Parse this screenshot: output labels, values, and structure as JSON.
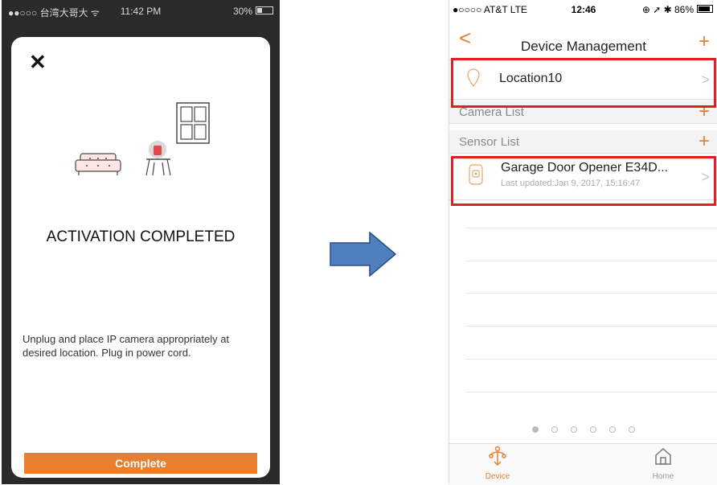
{
  "left": {
    "status": {
      "carrier": "●●○○○ 台湾大哥大 ᯤ",
      "time": "11:42 PM",
      "battery": "30%"
    },
    "close_label": "✕",
    "title": "ACTIVATION COMPLETED",
    "instruction": "Unplug and place IP camera appropriately at desired location. Plug in power cord.",
    "complete_label": "Complete"
  },
  "right": {
    "status": {
      "carrier": "●○○○○ AT&T  LTE",
      "time": "12:46",
      "icons": "⊕ ➚ ✱ 86%"
    },
    "nav": {
      "back": "<",
      "title": "Device Management",
      "add": "+"
    },
    "location": {
      "name": "Location10"
    },
    "sections": {
      "camera": "Camera List",
      "sensor": "Sensor List",
      "plus": "+"
    },
    "sensor": {
      "name": "Garage Door Opener E34D...",
      "updated": "Last updated:Jan 9, 2017, 15:16:47"
    },
    "chevron": ">",
    "page_dots": {
      "count": 6,
      "active": 0
    },
    "tabs": [
      {
        "label": "Device"
      },
      {
        "label": "Home"
      }
    ]
  },
  "colors": {
    "accent": "#e87e2e",
    "highlight": "#e41f1f",
    "arrow": "#4f7fbf"
  },
  "icons": [
    "close-icon",
    "back-chevron-icon",
    "add-icon",
    "location-pin-icon",
    "sensor-device-icon",
    "chevron-right-icon",
    "device-tab-icon",
    "home-tab-icon",
    "right-arrow-icon"
  ]
}
